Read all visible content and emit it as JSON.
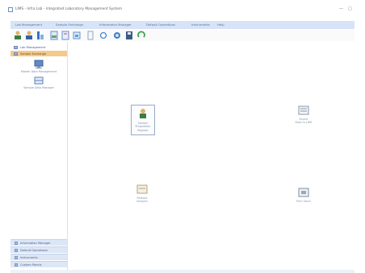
{
  "window": {
    "title": "LIMS - Infra.Lab - Integrated Laboratory Management System",
    "minimize_glyph": "—",
    "maximize_glyph": "□"
  },
  "menu": {
    "items": [
      "Lab Management",
      "Sample Exchange",
      "Information Manager",
      "Default Operations",
      "Instruments",
      "Help"
    ]
  },
  "toolbar": {
    "buttons": [
      "user-icon",
      "user-group-icon",
      "chart-icon",
      "file-open-icon",
      "file-edit-icon",
      "folder-tree-icon",
      "document-icon",
      "refresh-icon",
      "lab-icon",
      "save-icon",
      "reload-icon"
    ]
  },
  "sidebar": {
    "items": [
      {
        "label": "Lab Management",
        "icon": "computer-icon",
        "active": false
      },
      {
        "label": "Sample Exchange",
        "icon": "folder-icon",
        "active": true
      }
    ],
    "launchers": [
      {
        "label": "Master Data Management",
        "icon": "monitor-icon"
      },
      {
        "label": "Sample Data Manager",
        "icon": "database-icon"
      }
    ],
    "bottom_items": [
      "Information Manager",
      "Default Operations",
      "Instruments",
      "Custom Panels"
    ]
  },
  "main": {
    "tiles": [
      {
        "label_line1": "Sample Preparation",
        "label_line2": "Register",
        "icon": "analyst-icon",
        "selected": true
      },
      {
        "label_line1": "Export",
        "label_line2": "Data to LIMS",
        "icon": "export-icon",
        "selected": false
      },
      {
        "label_line1": "Release",
        "label_line2": "Samples",
        "icon": "release-icon",
        "selected": false
      },
      {
        "label_line1": "Print Stock",
        "label_line2": "",
        "icon": "print-icon",
        "selected": false
      }
    ]
  },
  "colors": {
    "menubar": "#d7e3f6",
    "sidebar_active": "#f5c98a",
    "accent": "#6f8fbf"
  }
}
